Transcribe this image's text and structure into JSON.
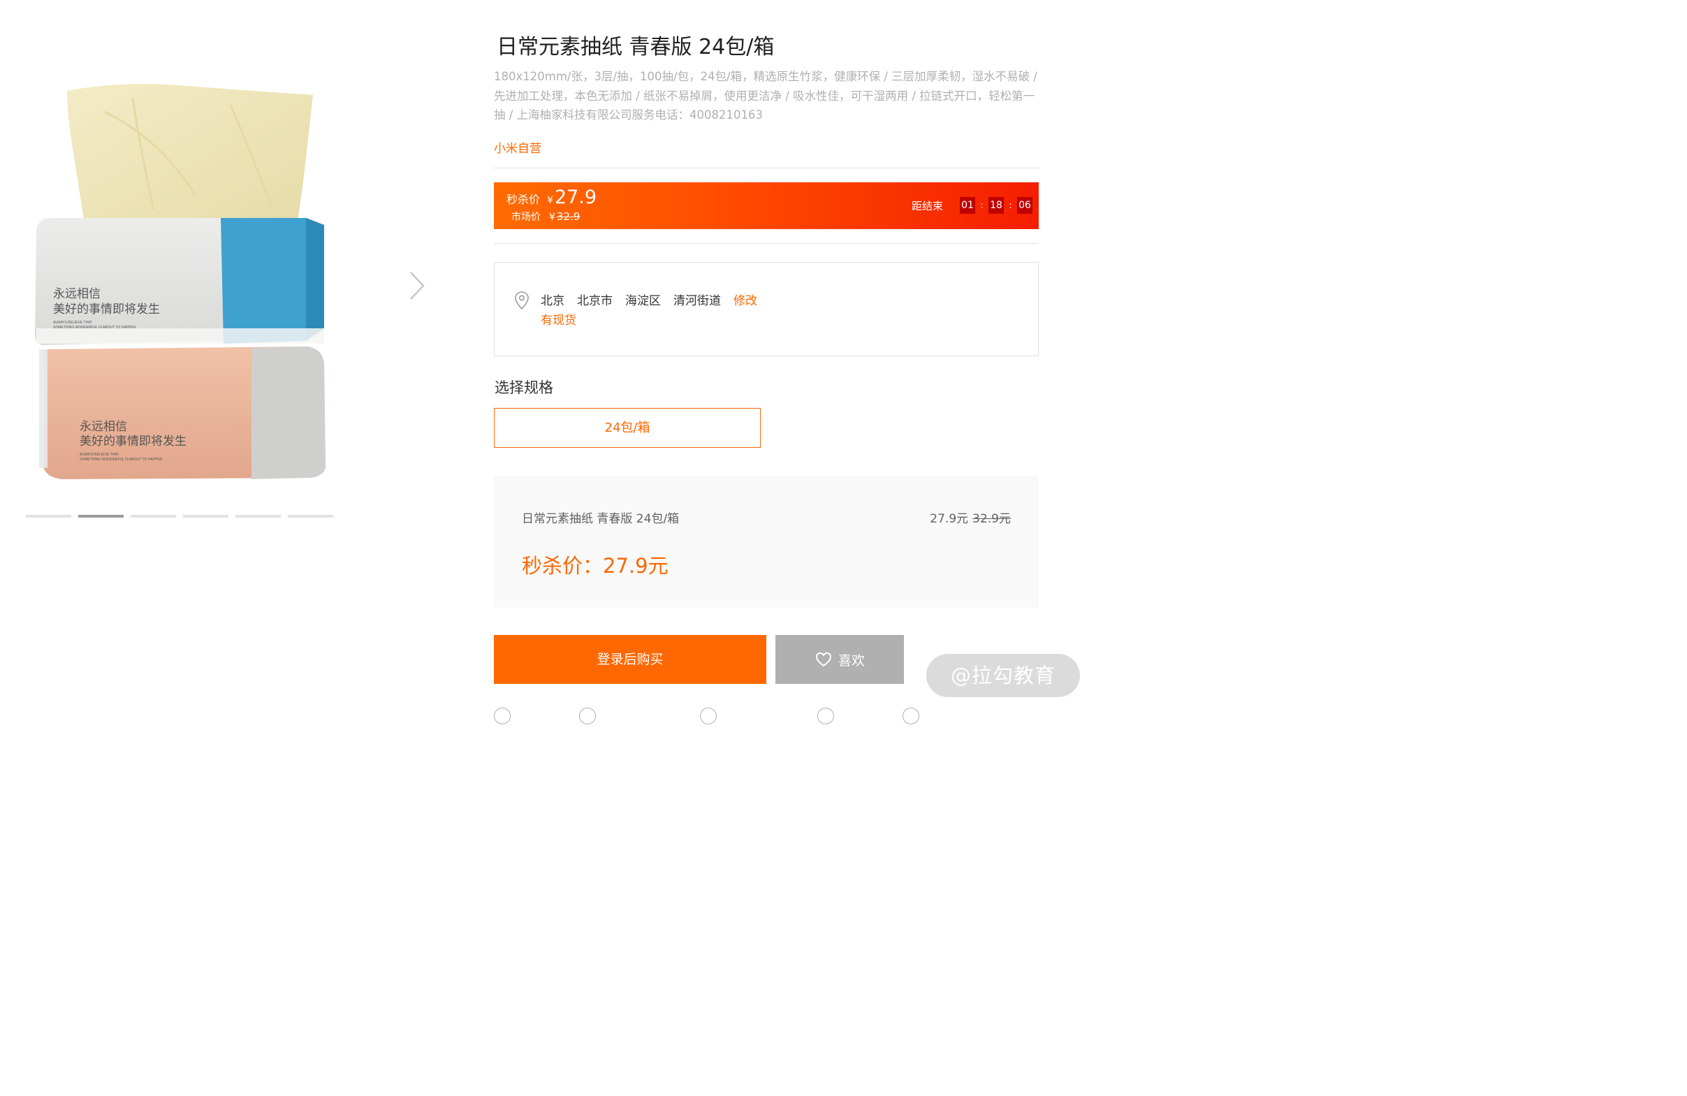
{
  "product": {
    "title": "日常元素抽纸 青春版 24包/箱",
    "description": "180x120mm/张，3层/抽，100抽/包，24包/箱，精选原生竹浆，健康环保 / 三层加厚柔韧，湿水不易破 / 先进加工处理，本色无添加 / 纸张不易掉屑，使用更洁净 / 吸水性佳，可干湿两用 / 拉链式开口，轻松第一抽 / 上海柚家科技有限公司服务电话：4008210163",
    "seller": "小米自营"
  },
  "photo": {
    "package_top_text_1": "永远相信",
    "package_top_text_2": "美好的事情即将发生",
    "package_top_small_1": "ALWAYS BELIEVE THAT",
    "package_top_small_2": "SOMETHING WONDERFUL IS ABOUT TO HAPPEN",
    "package_bottom_text_1": "永远相信",
    "package_bottom_text_2": "美好的事情即将发生",
    "package_bottom_small_1": "ALWAYS BELIEVE THAT",
    "package_bottom_small_2": "SOMETHING WONDERFUL IS ABOUT TO HAPPEN"
  },
  "gallery": {
    "slide_count": 6,
    "active_index": 1
  },
  "flash_sale": {
    "sale_label": "秒杀价",
    "currency": "¥",
    "sale_price": "27.9",
    "market_label": "市场价",
    "market_price": "32.9",
    "ends_label": "距结束",
    "hours": "01",
    "minutes": "18",
    "seconds": "06",
    "separator": ":"
  },
  "address": {
    "province": "北京",
    "city": "北京市",
    "district": "海淀区",
    "street": "清河街道",
    "edit_label": "修改",
    "stock_status": "有现货"
  },
  "spec": {
    "title": "选择规格",
    "selected_option": "24包/箱"
  },
  "summary": {
    "name": "日常元素抽纸 青春版 24包/箱",
    "price": "27.9元",
    "original_price": "32.9元",
    "total": "秒杀价：27.9元"
  },
  "actions": {
    "buy_label": "登录后购买",
    "like_label": "喜欢"
  },
  "watermark": "@拉勾教育",
  "colors": {
    "accent": "#ff6700",
    "flash_start": "#ff6b00",
    "flash_end": "#f41e00",
    "countdown_box": "#bf0000",
    "like_button": "#b0b0b0"
  }
}
